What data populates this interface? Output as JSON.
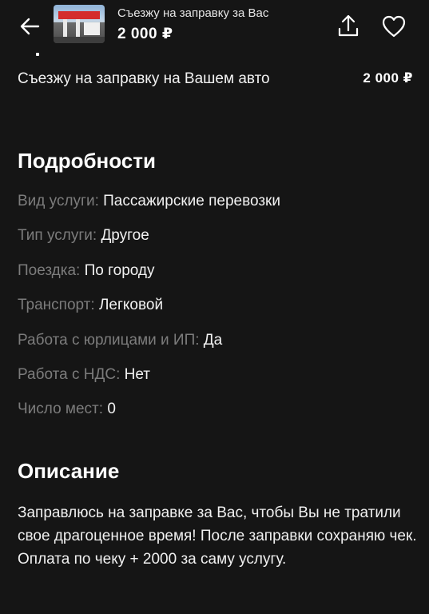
{
  "header": {
    "back_icon": "arrow-left-icon",
    "title": "Съезжу на заправку за Вас",
    "price": "2 000 ₽",
    "share_icon": "share-upload-icon",
    "favorite_icon": "heart-outline-icon"
  },
  "service": {
    "name": "Съезжу на заправку на Вашем авто",
    "price": "2 000 ₽"
  },
  "details": {
    "title": "Подробности",
    "items": [
      {
        "label": "Вид услуги:",
        "value": "Пассажирские перевозки"
      },
      {
        "label": "Тип услуги:",
        "value": "Другое"
      },
      {
        "label": "Поездка:",
        "value": "По городу"
      },
      {
        "label": "Транспорт:",
        "value": "Легковой"
      },
      {
        "label": "Работа с юрлицами и ИП:",
        "value": "Да"
      },
      {
        "label": "Работа с НДС:",
        "value": "Нет"
      },
      {
        "label": "Число мест:",
        "value": "0"
      }
    ]
  },
  "description": {
    "title": "Описание",
    "text": "Заправлюсь на заправке за Вас, чтобы Вы не тратили свое драгоценное время! После заправки сохраняю чек. Оплата по чеку + 2000 за саму услугу."
  }
}
